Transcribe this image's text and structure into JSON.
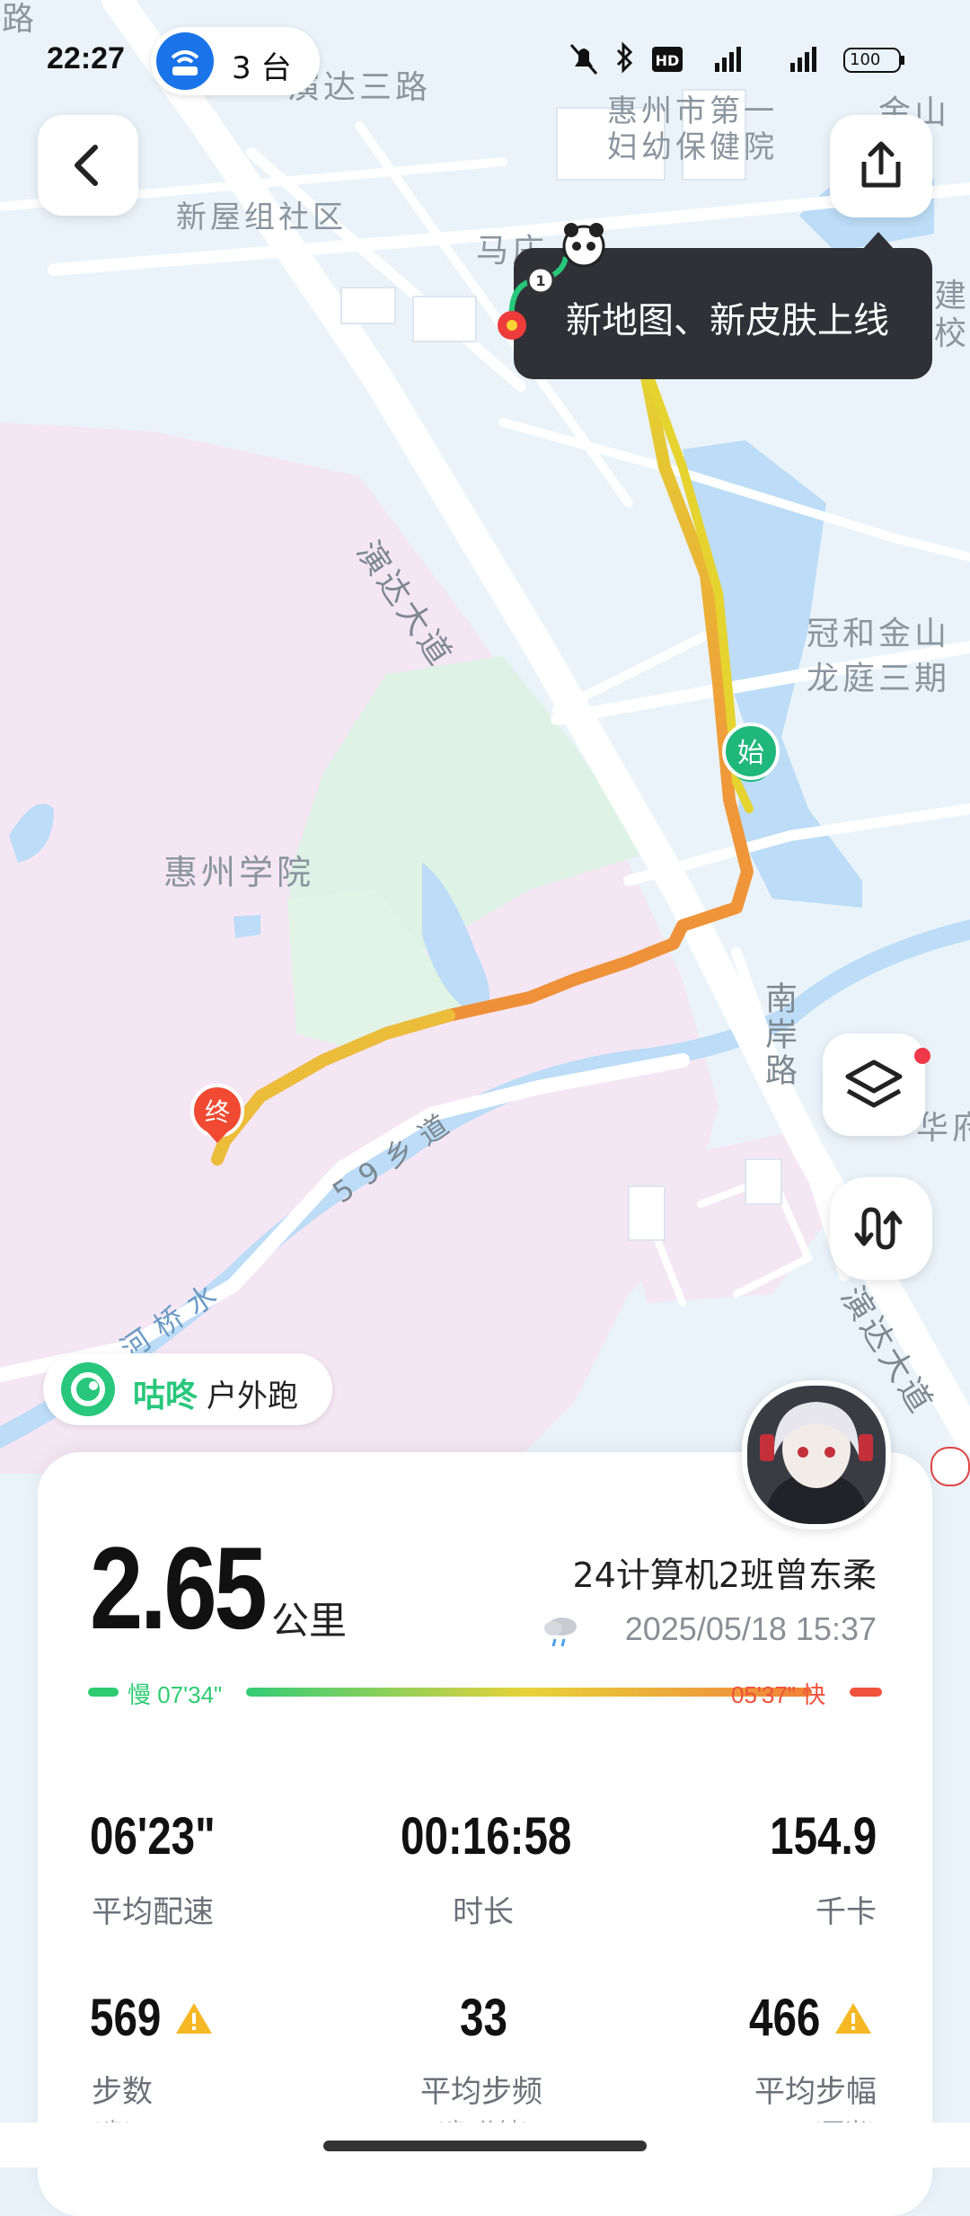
{
  "status_bar": {
    "time": "22:27",
    "devices": "3 台",
    "battery": "100"
  },
  "tooltip": {
    "text": "新地图、新皮肤上线"
  },
  "map": {
    "labels": [
      "路",
      "演达三路",
      "惠州市第一",
      "妇幼保健院",
      "金山",
      "新屋组社区",
      "马庄",
      "建",
      "校",
      "演达大道",
      "冠和金山",
      "龙庭三期",
      "惠州学院",
      "南岸路",
      "59乡道",
      "华府",
      "河桥水",
      "演达大道"
    ],
    "start_marker": "始",
    "end_marker": "终"
  },
  "brand": {
    "name": "咕咚",
    "activity": "户外跑"
  },
  "summary": {
    "distance": "2.65",
    "distance_unit": "公里",
    "user_name": "24计算机2班曾东柔",
    "datetime": "2025/05/18 15:37",
    "pace_slow": "慢 07'34\"",
    "pace_fast": "05'37\" 快"
  },
  "stats": {
    "avg_pace": {
      "value": "06'23\"",
      "label": "平均配速"
    },
    "duration": {
      "value": "00:16:58",
      "label": "时长"
    },
    "calories": {
      "value": "154.9",
      "label": "千卡"
    },
    "steps": {
      "value": "569",
      "label": "步数",
      "unit": "(步)"
    },
    "cadence": {
      "value": "33",
      "label": "平均步频",
      "unit": "(步/分钟)"
    },
    "stride": {
      "value": "466",
      "label": "平均步幅",
      "unit": "(厘米)"
    }
  },
  "colors": {
    "route_start": "#e6d634",
    "route_end": "#f08a3c",
    "slow": "#2ecc71",
    "fast": "#f0513c",
    "brand": "#28c77b",
    "start_pin": "#1fb87a",
    "end_pin": "#f04a32"
  },
  "icons": [
    "back-arrow-icon",
    "share-icon",
    "layers-icon",
    "route-switch-icon",
    "rain-cloud-icon",
    "warning-icon",
    "wifi-router-icon"
  ]
}
